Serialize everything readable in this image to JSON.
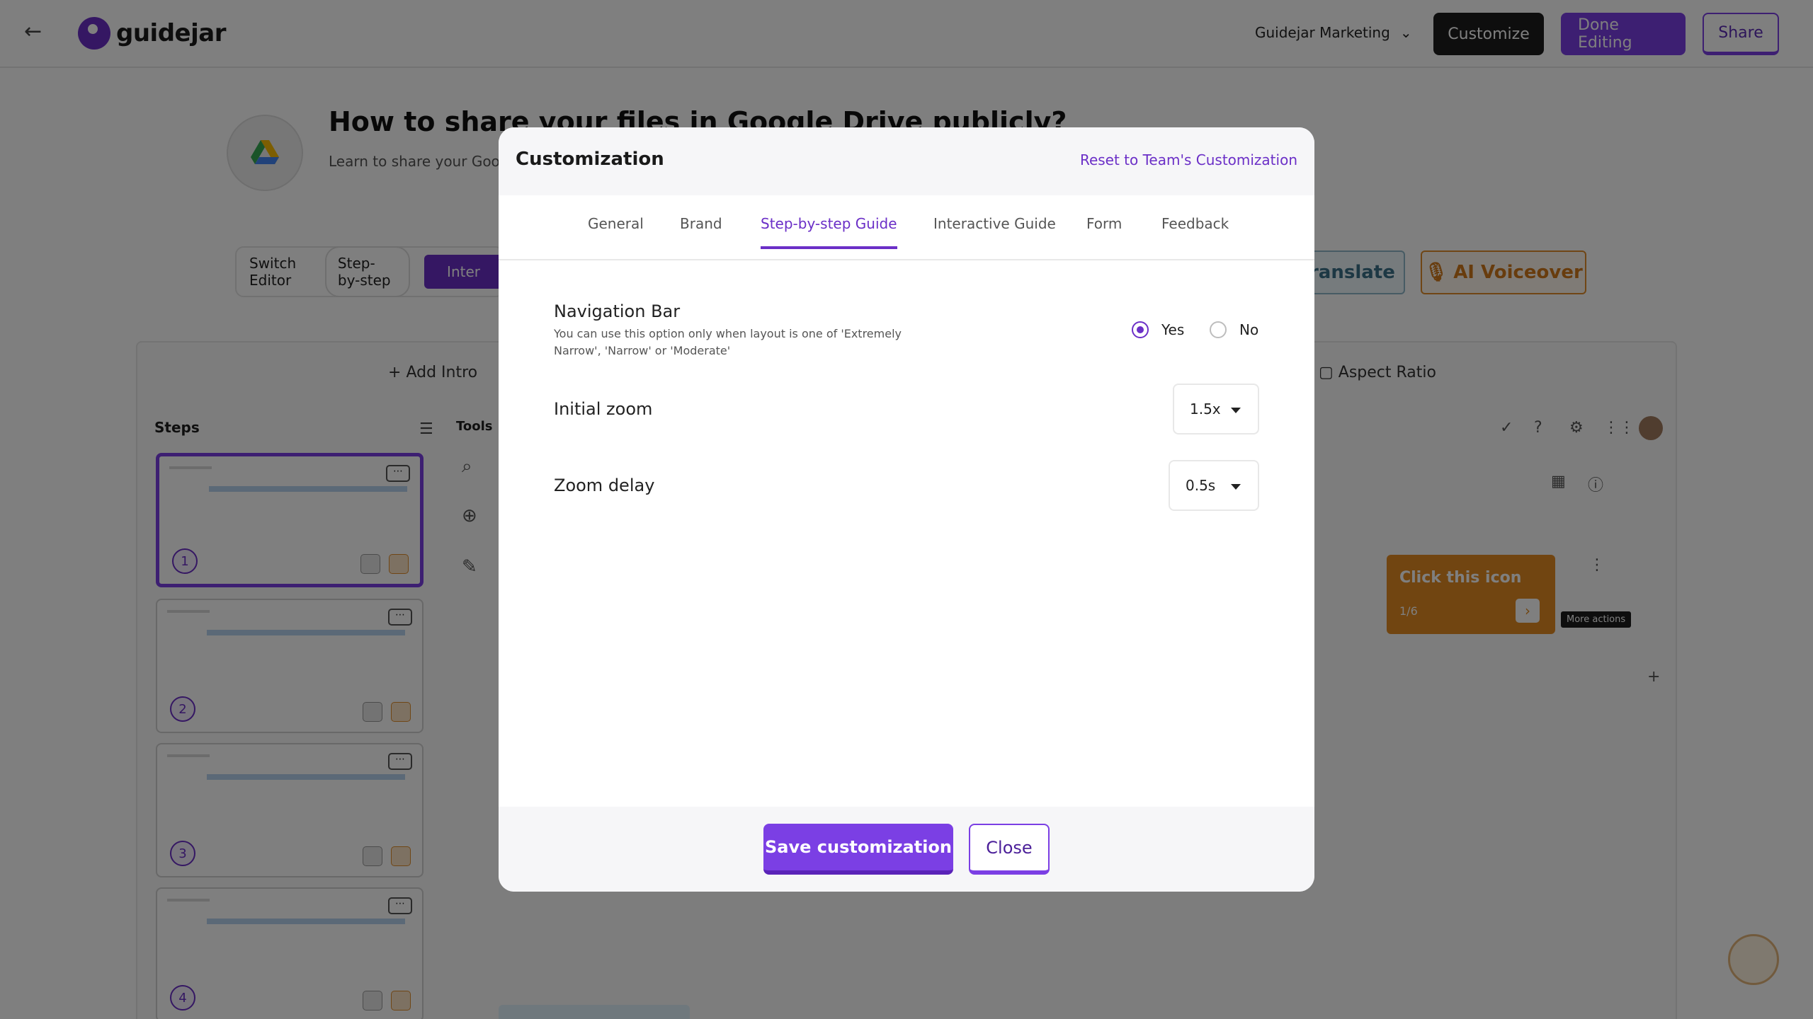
{
  "topbar": {
    "logo_text": "guidejar",
    "team_select": "Guidejar Marketing",
    "customize_label": "Customize",
    "done_editing_label": "Done Editing",
    "share_label": "Share"
  },
  "guide": {
    "title": "How to share your files in Google Drive publicly?",
    "subtitle": "Learn to share your Goog"
  },
  "editor": {
    "switch_label": "Switch Editor",
    "step_by_step_label": "Step-by-step",
    "interactive_label": "Inter",
    "translate_label": "Translate",
    "voiceover_label": "AI Voiceover",
    "add_intro_label": "Add Intro",
    "aspect_ratio_label": "Aspect Ratio",
    "steps_label": "Steps",
    "tools_label": "Tools",
    "steps": [
      {
        "number": "1"
      },
      {
        "number": "2"
      },
      {
        "number": "3"
      },
      {
        "number": "4"
      }
    ],
    "tooltip": {
      "title": "Click this icon",
      "counter": "1/6"
    },
    "more_actions_label": "More actions"
  },
  "modal": {
    "title": "Customization",
    "reset_link": "Reset to Team's Customization",
    "tabs": [
      {
        "label": "General"
      },
      {
        "label": "Brand"
      },
      {
        "label": "Step-by-step Guide",
        "active": true
      },
      {
        "label": "Interactive Guide"
      },
      {
        "label": "Form"
      },
      {
        "label": "Feedback"
      }
    ],
    "navigation_bar": {
      "label": "Navigation Bar",
      "help": "You can use this option only when layout is one of 'Extremely Narrow', 'Narrow' or 'Moderate'",
      "yes_label": "Yes",
      "no_label": "No",
      "selected": "Yes"
    },
    "initial_zoom": {
      "label": "Initial zoom",
      "value": "1.5x"
    },
    "zoom_delay": {
      "label": "Zoom delay",
      "value": "0.5s"
    },
    "save_label": "Save customization",
    "close_label": "Close"
  },
  "colors": {
    "accent": "#7b3fe4",
    "dark_button": "#1d1d1d",
    "tooltip": "#e38b23",
    "translate": "#3a7089",
    "voiceover": "#d0781a"
  }
}
